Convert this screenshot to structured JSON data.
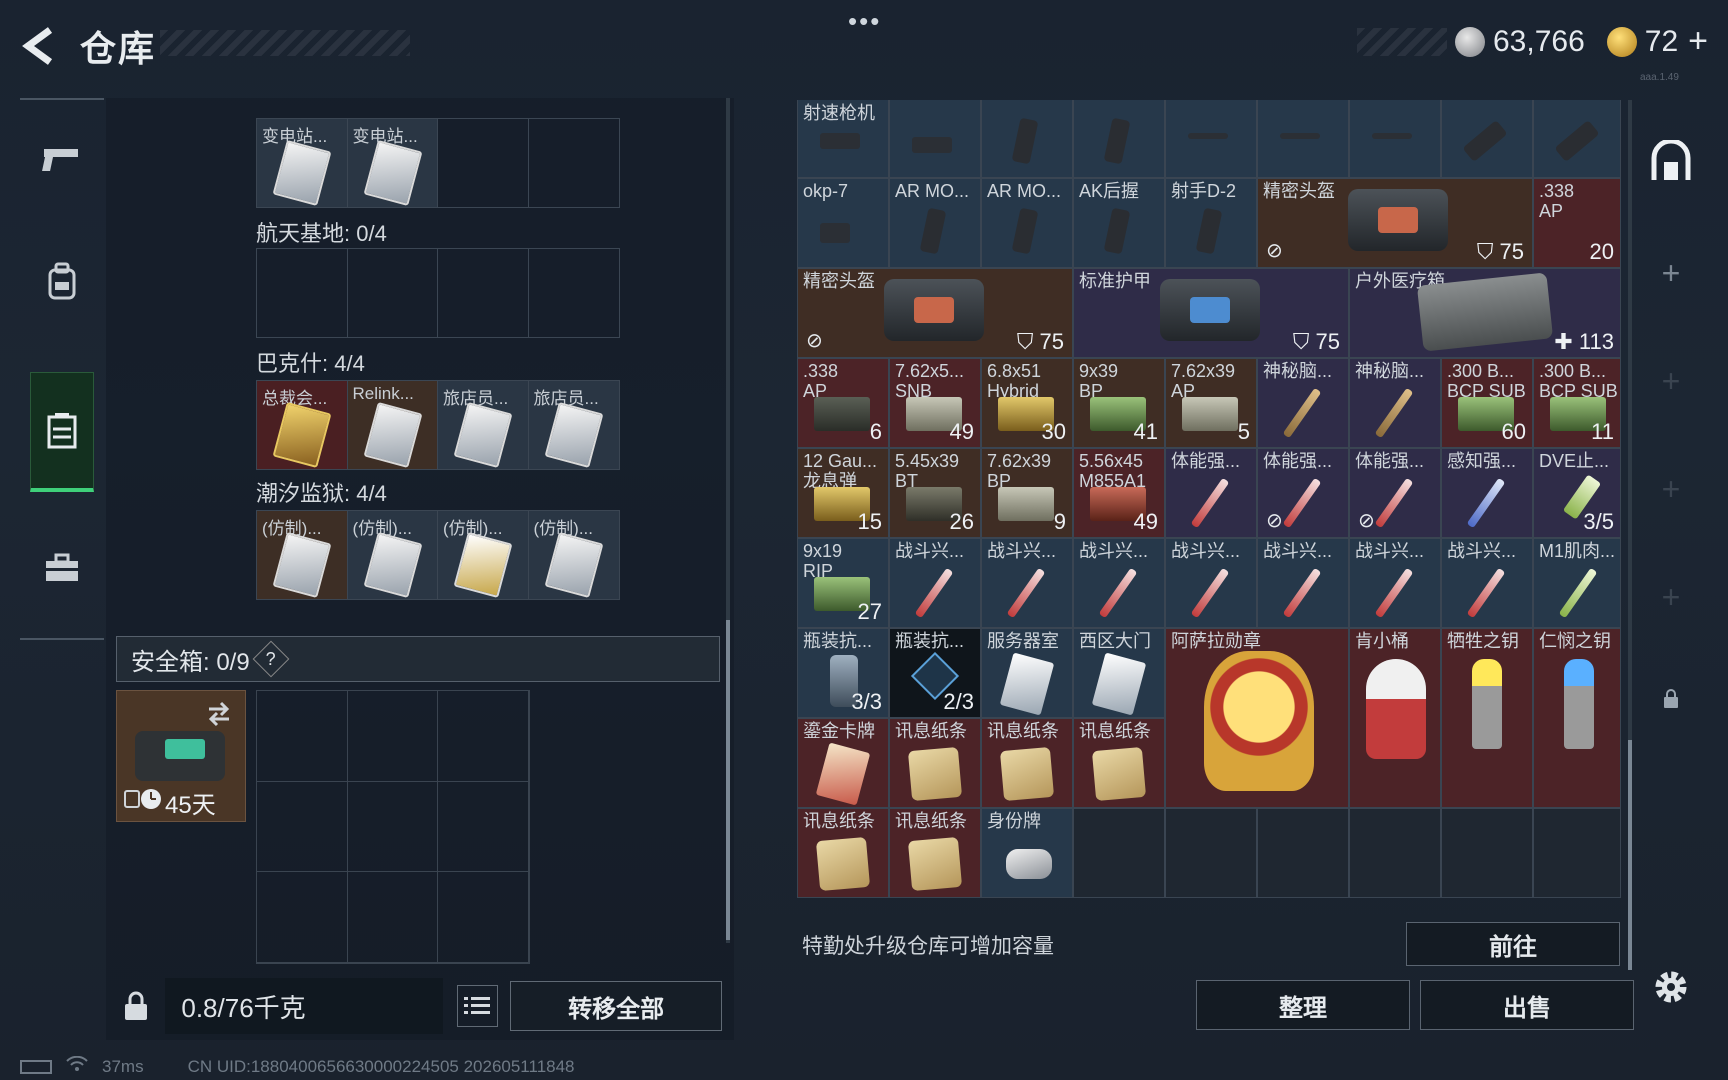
{
  "header": {
    "title": "仓库",
    "menu_dots": "•••",
    "currency_silver": "63,766",
    "currency_gold": "72",
    "plus": "+",
    "build_tag": "aaa.1.49"
  },
  "left_nav": [
    {
      "name": "weapons",
      "icon": "gun-icon"
    },
    {
      "name": "equipment",
      "icon": "backpack-icon"
    },
    {
      "name": "warehouse",
      "icon": "locker-icon",
      "active": true
    },
    {
      "name": "briefcase",
      "icon": "briefcase-icon"
    }
  ],
  "key_sections": {
    "top_partial_row": [
      {
        "label": "变电站...",
        "filled": true
      },
      {
        "label": "变电站...",
        "filled": true
      },
      {
        "label": "",
        "filled": false
      },
      {
        "label": "",
        "filled": false
      }
    ],
    "sections": [
      {
        "title": "航天基地: 0/4",
        "slots": [
          {
            "label": "",
            "filled": false,
            "type": ""
          },
          {
            "label": "",
            "filled": false,
            "type": ""
          },
          {
            "label": "",
            "filled": false,
            "type": ""
          },
          {
            "label": "",
            "filled": false,
            "type": ""
          }
        ]
      },
      {
        "title": "巴克什: 4/4",
        "slots": [
          {
            "label": "总裁会...",
            "filled": true,
            "type": "gold"
          },
          {
            "label": "Relink...",
            "filled": true,
            "type": "brown"
          },
          {
            "label": "旅店员...",
            "filled": true,
            "type": "blue"
          },
          {
            "label": "旅店员...",
            "filled": true,
            "type": "blue"
          }
        ]
      },
      {
        "title": "潮汐监狱: 4/4",
        "slots": [
          {
            "label": "(仿制)...",
            "filled": true,
            "type": "brown"
          },
          {
            "label": "(仿制)...",
            "filled": true,
            "type": "blue"
          },
          {
            "label": "(仿制)...",
            "filled": true,
            "type": "blue"
          },
          {
            "label": "(仿制)...",
            "filled": true,
            "type": "blue"
          }
        ]
      }
    ]
  },
  "safe_box": {
    "label": "安全箱: 0/9",
    "help": "?",
    "duration": "45天",
    "swap_icon": "swap-icon"
  },
  "weight": {
    "value": "0.8/76千克",
    "transfer_all": "转移全部"
  },
  "storage": {
    "rows": [
      [
        {
          "name": "射速枪机",
          "bg": "blue",
          "icon": "gun"
        },
        {
          "name": "",
          "bg": "blue",
          "icon": "gun"
        },
        {
          "name": "",
          "bg": "blue",
          "icon": "grip"
        },
        {
          "name": "",
          "bg": "blue",
          "icon": "grip"
        },
        {
          "name": "",
          "bg": "blue",
          "icon": "gun"
        },
        {
          "name": "",
          "bg": "blue",
          "icon": "gun"
        },
        {
          "name": "",
          "bg": "blue",
          "icon": "gun"
        },
        {
          "name": "",
          "bg": "blue",
          "icon": "grip"
        },
        {
          "name": "",
          "bg": "blue",
          "icon": "grip"
        }
      ],
      [
        {
          "name": "okp-7",
          "bg": "blue",
          "icon": "gun"
        },
        {
          "name": "AR MO...",
          "bg": "blue",
          "icon": "grip"
        },
        {
          "name": "AR MO...",
          "bg": "blue",
          "icon": "grip"
        },
        {
          "name": "AK后握",
          "bg": "blue",
          "icon": "grip"
        },
        {
          "name": "射手D-2",
          "bg": "blue",
          "icon": "grip"
        }
      ]
    ],
    "big_items": [
      {
        "name": "精密头盔",
        "armor": "75"
      },
      {
        "name": "精密头盔",
        "armor": "75"
      },
      {
        "name": "标准护甲",
        "armor": "75"
      },
      {
        "name": "户外医疗箱",
        "count": "113"
      },
      {
        "name": ".338 AP",
        "count": "20"
      }
    ],
    "ammo_row": [
      {
        "name": ".338 AP",
        "count": "6"
      },
      {
        "name": "7.62x5... SNB",
        "count": "49"
      },
      {
        "name": "6.8x51 Hybrid",
        "count": "30"
      },
      {
        "name": "9x39 BP",
        "count": "41"
      },
      {
        "name": "7.62x39 AP",
        "count": "5"
      },
      {
        "name": "神秘脑...",
        "count": ""
      },
      {
        "name": "神秘脑...",
        "count": ""
      },
      {
        "name": ".300 B... BCP SUB",
        "count": "60"
      },
      {
        "name": ".300 B... BCP SUB",
        "count": "11"
      }
    ],
    "row5": [
      {
        "name": "12 Gau... 龙息弹",
        "count": "15"
      },
      {
        "name": "5.45x39 BT",
        "count": "26"
      },
      {
        "name": "7.62x39 BP",
        "count": "9"
      },
      {
        "name": "5.56x45 M855A1",
        "count": "49"
      },
      {
        "name": "体能强...",
        "count": ""
      },
      {
        "name": "体能强...",
        "count": ""
      },
      {
        "name": "体能强...",
        "count": ""
      },
      {
        "name": "感知强...",
        "count": ""
      },
      {
        "name": "DVE止...",
        "count": "3/5"
      }
    ],
    "row6": [
      {
        "name": "9x19 RIP",
        "count": "27"
      },
      {
        "name": "战斗兴...",
        "count": ""
      },
      {
        "name": "战斗兴...",
        "count": ""
      },
      {
        "name": "战斗兴...",
        "count": ""
      },
      {
        "name": "战斗兴...",
        "count": ""
      },
      {
        "name": "战斗兴...",
        "count": ""
      },
      {
        "name": "战斗兴...",
        "count": ""
      },
      {
        "name": "战斗兴...",
        "count": ""
      },
      {
        "name": "M1肌肉...",
        "count": ""
      }
    ],
    "row7": [
      {
        "name": "瓶装抗...",
        "count": "3/3"
      },
      {
        "name": "瓶装抗...",
        "count": "2/3"
      },
      {
        "name": "服务器室",
        "count": ""
      },
      {
        "name": "西区大门",
        "count": ""
      },
      {
        "name": "阿萨拉勋章",
        "count": ""
      },
      {
        "name": "肯小桶",
        "count": ""
      },
      {
        "name": "牺牲之钥",
        "count": ""
      },
      {
        "name": "仁悯之钥",
        "count": ""
      }
    ],
    "row8": [
      {
        "name": "鎏金卡牌"
      },
      {
        "name": "讯息纸条"
      },
      {
        "name": "讯息纸条"
      },
      {
        "name": "讯息纸条"
      }
    ],
    "row9": [
      {
        "name": "讯息纸条"
      },
      {
        "name": "讯息纸条"
      },
      {
        "name": "身份牌"
      }
    ]
  },
  "footer": {
    "upgrade_hint": "特勤处升级仓库可增加容量",
    "goto": "前往",
    "sort": "整理",
    "sell": "出售"
  },
  "status": {
    "ping": "37ms",
    "uid": "CN UID:1880400656630000224505 202605111848"
  }
}
